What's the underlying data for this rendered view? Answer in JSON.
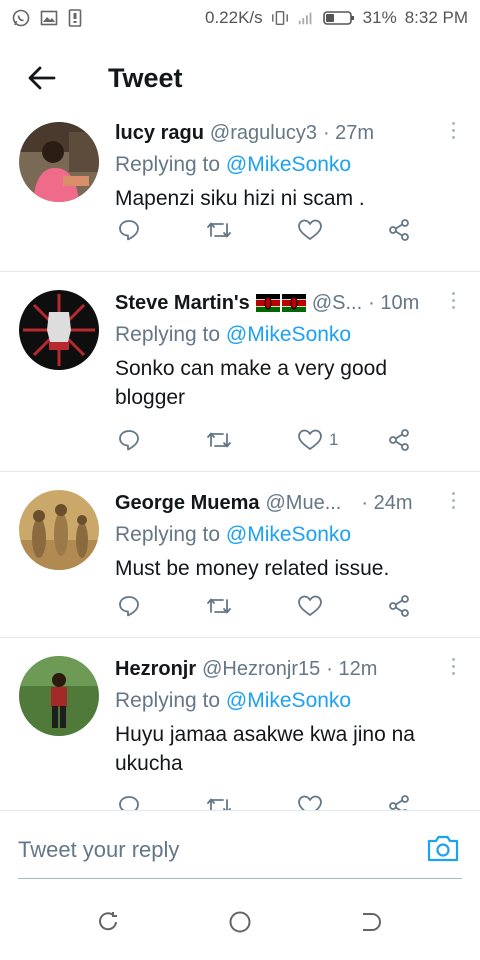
{
  "status_bar": {
    "speed": "0.22K/s",
    "battery": "31%",
    "time": "8:32 PM"
  },
  "header": {
    "title": "Tweet"
  },
  "tweets": [
    {
      "name": "lucy ragu",
      "handle": "@ragulucy3",
      "time": "· 27m",
      "reply_prefix": "Replying to ",
      "reply_to": "@MikeSonko",
      "text": "Mapenzi siku hizi ni scam .",
      "likes": ""
    },
    {
      "name": "Steve Martin's",
      "handle": "@S...",
      "time": "· 10m",
      "reply_prefix": "Replying to ",
      "reply_to": "@MikeSonko",
      "text": "Sonko can make a very  good blogger",
      "likes": "1"
    },
    {
      "name": "George Muema",
      "handle": "@Mue...",
      "time": "· 24m",
      "reply_prefix": "Replying to ",
      "reply_to": "@MikeSonko",
      "text": "Must be money related issue.",
      "likes": ""
    },
    {
      "name": "Hezronjr",
      "handle": "@Hezronjr15",
      "time": "· 12m",
      "reply_prefix": "Replying to ",
      "reply_to": "@MikeSonko",
      "text": "Huyu jamaa asakwe kwa jino na ukucha",
      "likes": ""
    }
  ],
  "reply_box": {
    "placeholder": "Tweet your reply"
  },
  "icons": [
    "whatsapp-icon",
    "gallery-icon",
    "sim-icon",
    "vibrate-icon",
    "signal-icon",
    "battery-icon",
    "back-arrow-icon",
    "more-icon",
    "reply-icon",
    "retweet-icon",
    "like-icon",
    "share-icon",
    "camera-icon",
    "recents-icon",
    "home-icon",
    "nav-back-icon"
  ],
  "colors": {
    "accent": "#1da1f2",
    "flag_green": "#006600",
    "flag_red": "#bb0000"
  }
}
